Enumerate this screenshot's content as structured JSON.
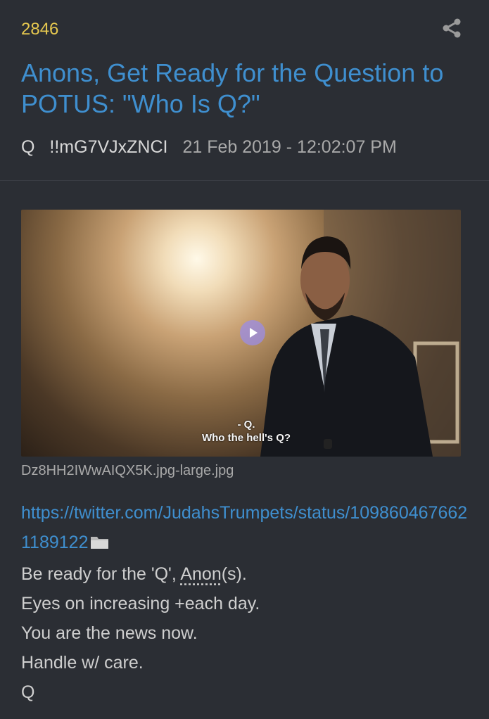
{
  "post": {
    "number": "2846",
    "title": "Anons, Get Ready for the Question to POTUS: \"Who Is Q?\"",
    "author": "Q",
    "tripcode": "!!mG7VJxZNCI",
    "date": "21 Feb 2019 - 12:02:07 PM"
  },
  "media": {
    "subtitle_line1": "- Q.",
    "subtitle_line2": "Who the hell's Q?",
    "filename": "Dz8HH2IWwAIQX5K.jpg-large.jpg"
  },
  "body": {
    "link": "https://twitter.com/JudahsTrumpets/status/1098604676621189122",
    "line1_prefix": "Be ready for the 'Q', ",
    "line1_anon": "Anon",
    "line1_suffix": "(s).",
    "line2": "Eyes on increasing +each day.",
    "line3": "You are the news now.",
    "line4": "Handle w/ care.",
    "signature": "Q"
  },
  "icons": {
    "share": "share-icon",
    "folder": "folder-icon",
    "play": "play-icon"
  },
  "colors": {
    "background": "#2b2e34",
    "post_number": "#e6c84f",
    "title": "#3f8fcf",
    "link": "#3f8fcf",
    "text": "#cfcfcf"
  }
}
